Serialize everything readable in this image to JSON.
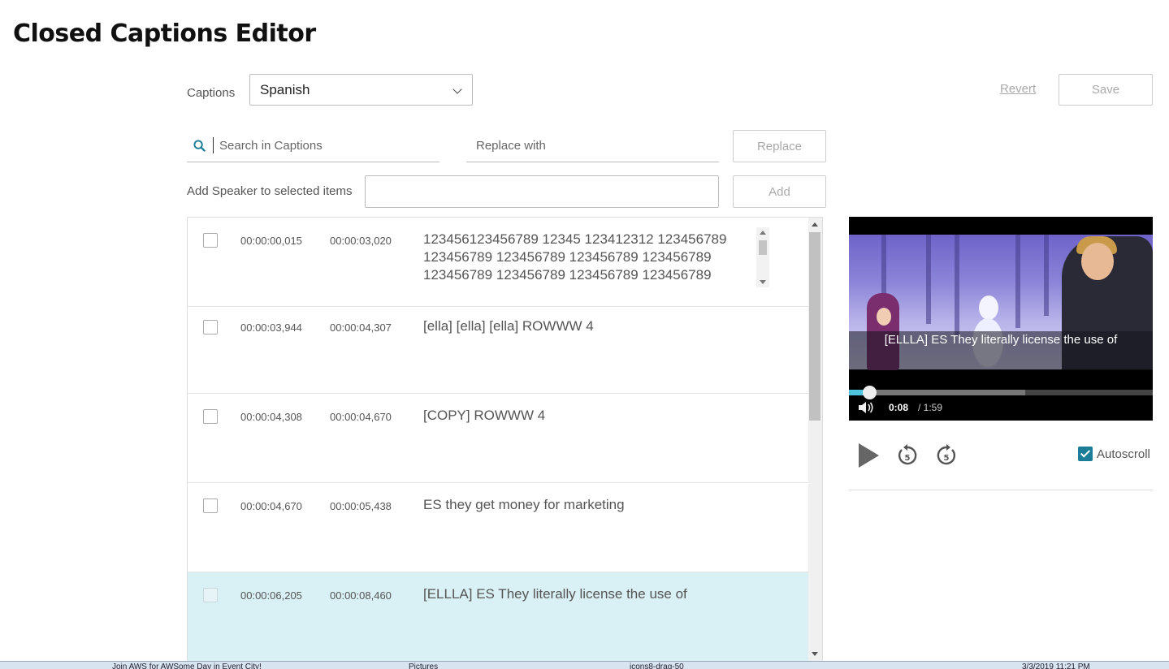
{
  "page": {
    "title": "Closed Captions Editor"
  },
  "captions_select": {
    "label": "Captions",
    "value": "Spanish"
  },
  "toolbar": {
    "revert_label": "Revert",
    "save_label": "Save"
  },
  "search": {
    "placeholder": "Search in Captions"
  },
  "replace": {
    "placeholder": "Replace with",
    "button_label": "Replace"
  },
  "speaker": {
    "label": "Add Speaker to selected items",
    "value": "",
    "button_label": "Add"
  },
  "caption_rows": [
    {
      "start": "00:00:00,015",
      "end": "00:00:03,020",
      "text": "123456123456789 12345 123412312 123456789 123456789 123456789 123456789 123456789 123456789 123456789 123456789 123456789",
      "selected": false
    },
    {
      "start": "00:00:03,944",
      "end": "00:00:04,307",
      "text": "[ella] [ella] [ella] ROWWW 4",
      "selected": false
    },
    {
      "start": "00:00:04,308",
      "end": "00:00:04,670",
      "text": "[COPY] ROWWW 4",
      "selected": false
    },
    {
      "start": "00:00:04,670",
      "end": "00:00:05,438",
      "text": "ES they get money for marketing",
      "selected": false
    },
    {
      "start": "00:00:06,205",
      "end": "00:00:08,460",
      "text": "[ELLLA] ES They literally license the use of",
      "selected": true
    }
  ],
  "player": {
    "caption_overlay": "[ELLLA] ES They literally license the use of",
    "current_time": "0:08",
    "duration": "/ 1:59",
    "progress": 0.067,
    "buffered": 0.58,
    "accent_color": "#4ec3dd"
  },
  "controls": {
    "play_icon": "play-icon",
    "rewind_icon": "rewind-5-icon",
    "forward_icon": "forward-5-icon",
    "rewind_seconds": "5",
    "forward_seconds": "5",
    "autoscroll_label": "Autoscroll",
    "autoscroll_checked": true
  },
  "taskbar": {
    "items": [
      "Join AWS for AWSome Day in Event City!",
      "Pictures",
      "icons8-drag-50",
      "3/3/2019 11:21 PM"
    ]
  }
}
